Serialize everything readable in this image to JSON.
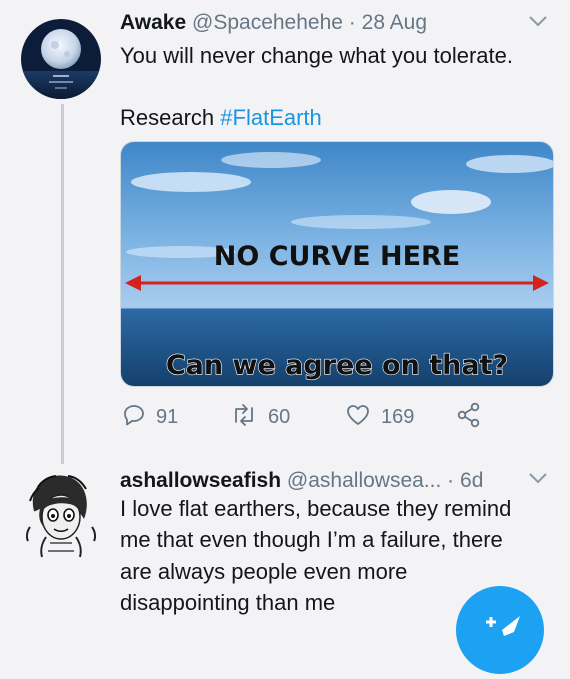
{
  "tweet1": {
    "display_name": "Awake",
    "handle": "@Spacehehehe",
    "separator": "·",
    "date": "28 Aug",
    "line1": "You will never change what you tolerate.",
    "research_prefix": "Research",
    "hashtag": "#FlatEarth",
    "image_text_top": "NO CURVE HERE",
    "image_text_bottom": "Can we agree on that?",
    "replies": "91",
    "retweets": "60",
    "likes": "169"
  },
  "tweet2": {
    "display_name": "ashallowseafish",
    "handle": "@ashallowsea...",
    "separator": "·",
    "date": "6d",
    "lines": [
      "I love flat earthers, because they remind",
      "me that even though I’m a failure, there",
      "are always people even more",
      "disappointing than me"
    ]
  },
  "icons": {
    "reply": "reply-icon",
    "retweet": "retweet-icon",
    "like": "heart-icon",
    "share": "share-icon",
    "more": "chevron-down-icon",
    "compose": "compose-tweet-icon"
  },
  "colors": {
    "accent": "#1b95e0",
    "muted": "#657786",
    "background": "#f3f3f5"
  }
}
